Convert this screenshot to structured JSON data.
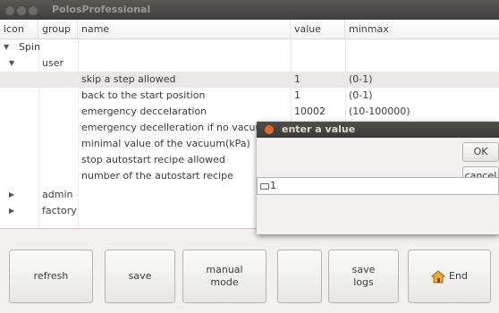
{
  "window": {
    "title": "PolosProfessional"
  },
  "columns": [
    "icon",
    "group",
    "name",
    "value",
    "minmax"
  ],
  "tree": {
    "spin": "Spin",
    "user": "user",
    "admin": "admin",
    "factory": "factory"
  },
  "rows": [
    {
      "name": "skip a step allowed",
      "value": "1",
      "minmax": "(0-1)"
    },
    {
      "name": "back to the start position",
      "value": "1",
      "minmax": "(0-1)"
    },
    {
      "name": "emergency deccelaration",
      "value": "10002",
      "minmax": "(10-100000)"
    },
    {
      "name": "emergency decelleration if no vacuum",
      "value": "",
      "minmax": ""
    },
    {
      "name": "minimal value of the vacuum(kPa)",
      "value": "",
      "minmax": ""
    },
    {
      "name": "stop autostart recipe allowed",
      "value": "",
      "minmax": ""
    },
    {
      "name": "number of the autostart recipe",
      "value": "",
      "minmax": ""
    }
  ],
  "buttons": {
    "refresh": "refresh",
    "save": "save",
    "manual_mode": "manual\nmode",
    "blank": "",
    "save_logs": "save\nlogs",
    "end": "End"
  },
  "dialog": {
    "title": "enter a value",
    "ok": "OK",
    "cancel": "cancel",
    "input_value": "1"
  }
}
